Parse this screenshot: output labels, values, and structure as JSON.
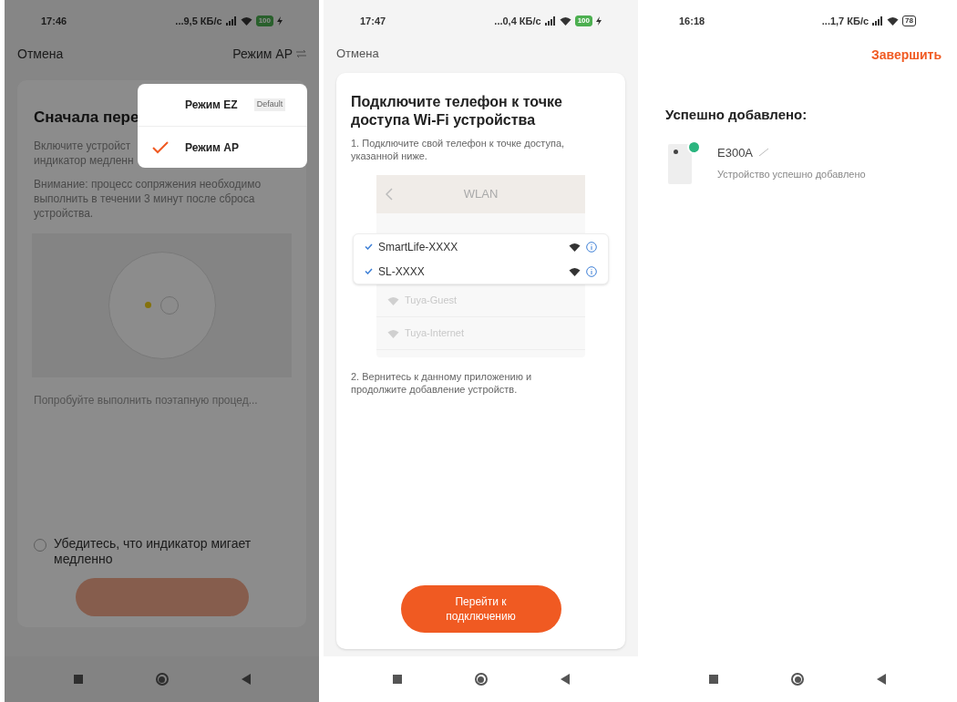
{
  "screens": [
    {
      "kind": "mode_select",
      "dimmed": true,
      "status_bar": {
        "time": "17:46",
        "net_speed": "...9,5 КБ/с",
        "battery": "100",
        "charging": true
      },
      "header": {
        "cancel": "Отмена",
        "mode": "Режим AP"
      },
      "card": {
        "title": "Сначала пере",
        "lines": [
          "Включите устройст",
          "индикатор медленн"
        ],
        "note": "Внимание: процесс сопряжения необходимо выполнить в течении 3 минут после сброса устройства.",
        "help_link": "Попробуйте выполнить поэтапную процед...",
        "confirm": {
          "label": "Убедитесь, что индикатор мигает медленно",
          "checked": false
        }
      },
      "mode_menu": [
        {
          "label": "Режим EZ",
          "badge": "Default",
          "selected": false
        },
        {
          "label": "Режим AP",
          "selected": true
        }
      ]
    },
    {
      "kind": "connect_ap",
      "dimmed": false,
      "status_bar": {
        "time": "17:47",
        "net_speed": "...0,4 КБ/с",
        "battery": "100",
        "charging": true
      },
      "header": {
        "cancel": "Отмена"
      },
      "card": {
        "title": "Подключите телефон к точке доступа Wi-Fi устройства",
        "step_1": "1. Подключите свой телефон к точке доступа, указанной ниже.",
        "wlan": {
          "title": "WLAN",
          "networks": [
            {
              "name": "SmartLife-XXXX",
              "highlighted": true
            },
            {
              "name": "SL-XXXX",
              "highlighted": true
            },
            {
              "name": "Tuya-Guest",
              "highlighted": false
            },
            {
              "name": "Tuya-Internet",
              "highlighted": false
            }
          ]
        },
        "step_2": "2. Вернитесь к данному приложению и продолжите добавление устройств.",
        "button": "Перейти к подключению"
      }
    },
    {
      "kind": "success",
      "dimmed": false,
      "status_bar": {
        "time": "16:18",
        "net_speed": "...1,7 КБ/с",
        "battery": "78",
        "charging": false
      },
      "header": {
        "finish": "Завершить"
      },
      "title": "Успешно добавлено:",
      "devices": [
        {
          "name": "E300A",
          "status": "Устройство успешно добавлено"
        }
      ]
    }
  ]
}
